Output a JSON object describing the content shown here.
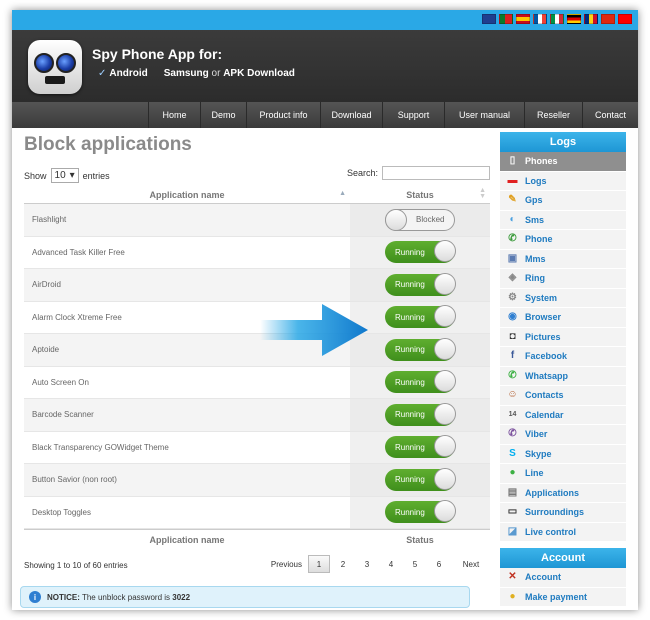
{
  "header": {
    "title": "Spy Phone App for:",
    "platform": "Android",
    "subtitle_brand": "Samsung",
    "subtitle_or": "or",
    "subtitle_rest": "APK Download"
  },
  "flags": [
    "gb",
    "pt",
    "es",
    "fr",
    "it",
    "de",
    "ro",
    "cn",
    "tw"
  ],
  "nav": [
    "Home",
    "Demo",
    "Product info",
    "Download",
    "Support",
    "User manual",
    "Reseller",
    "Contact"
  ],
  "page": {
    "title": "Block applications",
    "show_label": "Show",
    "entries_value": "10",
    "entries_label": "entries",
    "search_label": "Search:",
    "col_app": "Application name",
    "col_status": "Status",
    "info": "Showing 1 to 10 of 60 entries"
  },
  "rows": [
    {
      "name": "Flashlight",
      "status": "Blocked",
      "on": false
    },
    {
      "name": "Advanced Task Killer Free",
      "status": "Running",
      "on": true
    },
    {
      "name": "AirDroid",
      "status": "Running",
      "on": true
    },
    {
      "name": "Alarm Clock Xtreme Free",
      "status": "Running",
      "on": true
    },
    {
      "name": "Aptoide",
      "status": "Running",
      "on": true
    },
    {
      "name": "Auto Screen On",
      "status": "Running",
      "on": true
    },
    {
      "name": "Barcode Scanner",
      "status": "Running",
      "on": true
    },
    {
      "name": "Black Transparency GOWidget Theme",
      "status": "Running",
      "on": true
    },
    {
      "name": "Button Savior (non root)",
      "status": "Running",
      "on": true
    },
    {
      "name": "Desktop Toggles",
      "status": "Running",
      "on": true
    }
  ],
  "pager": {
    "previous": "Previous",
    "pages": [
      "1",
      "2",
      "3",
      "4",
      "5",
      "6"
    ],
    "current": "1",
    "next": "Next"
  },
  "notice": {
    "label": "NOTICE:",
    "text": "The unblock password is",
    "password": "3022"
  },
  "sidebar": {
    "logs_heading": "Logs",
    "items": [
      {
        "label": "Phones",
        "icon": "phone-device-icon",
        "glyph": "▯",
        "color": "#5aa0e0",
        "active": true
      },
      {
        "label": "Logs",
        "icon": "logs-icon",
        "glyph": "▬",
        "color": "#e02020"
      },
      {
        "label": "Gps",
        "icon": "gps-icon",
        "glyph": "✎",
        "color": "#e0a020"
      },
      {
        "label": "Sms",
        "icon": "sms-icon",
        "glyph": "◐",
        "color": "#4aa0e0"
      },
      {
        "label": "Phone",
        "icon": "call-icon",
        "glyph": "✆",
        "color": "#3a9a3a"
      },
      {
        "label": "Mms",
        "icon": "mms-icon",
        "glyph": "▣",
        "color": "#5a7ab0"
      },
      {
        "label": "Ring",
        "icon": "ring-icon",
        "glyph": "◈",
        "color": "#888888"
      },
      {
        "label": "System",
        "icon": "system-icon",
        "glyph": "⚙",
        "color": "#888888"
      },
      {
        "label": "Browser",
        "icon": "browser-icon",
        "glyph": "◉",
        "color": "#2f7fd1"
      },
      {
        "label": "Pictures",
        "icon": "camera-icon",
        "glyph": "◘",
        "color": "#333333"
      },
      {
        "label": "Facebook",
        "icon": "facebook-icon",
        "glyph": "f",
        "color": "#3b5998"
      },
      {
        "label": "Whatsapp",
        "icon": "whatsapp-icon",
        "glyph": "✆",
        "color": "#3cb043"
      },
      {
        "label": "Contacts",
        "icon": "contacts-icon",
        "glyph": "☺",
        "color": "#b05a2a"
      },
      {
        "label": "Calendar",
        "icon": "calendar-icon",
        "glyph": "14",
        "color": "#555555"
      },
      {
        "label": "Viber",
        "icon": "viber-icon",
        "glyph": "✆",
        "color": "#7b519d"
      },
      {
        "label": "Skype",
        "icon": "skype-icon",
        "glyph": "S",
        "color": "#00aff0"
      },
      {
        "label": "Line",
        "icon": "line-icon",
        "glyph": "●",
        "color": "#3cb043"
      },
      {
        "label": "Applications",
        "icon": "applications-icon",
        "glyph": "▤",
        "color": "#777777"
      },
      {
        "label": "Surroundings",
        "icon": "surroundings-icon",
        "glyph": "▭",
        "color": "#333333"
      },
      {
        "label": "Live control",
        "icon": "live-control-icon",
        "glyph": "◪",
        "color": "#5a9ad0"
      }
    ],
    "account_heading": "Account",
    "account_items": [
      {
        "label": "Account",
        "icon": "account-icon",
        "glyph": "✕",
        "color": "#c03020"
      },
      {
        "label": "Make payment",
        "icon": "payment-icon",
        "glyph": "●",
        "color": "#e0b020"
      }
    ]
  },
  "colors": {
    "accent": "#2aa8e6",
    "running": "#4a9e24",
    "link": "#1f7bc0"
  }
}
